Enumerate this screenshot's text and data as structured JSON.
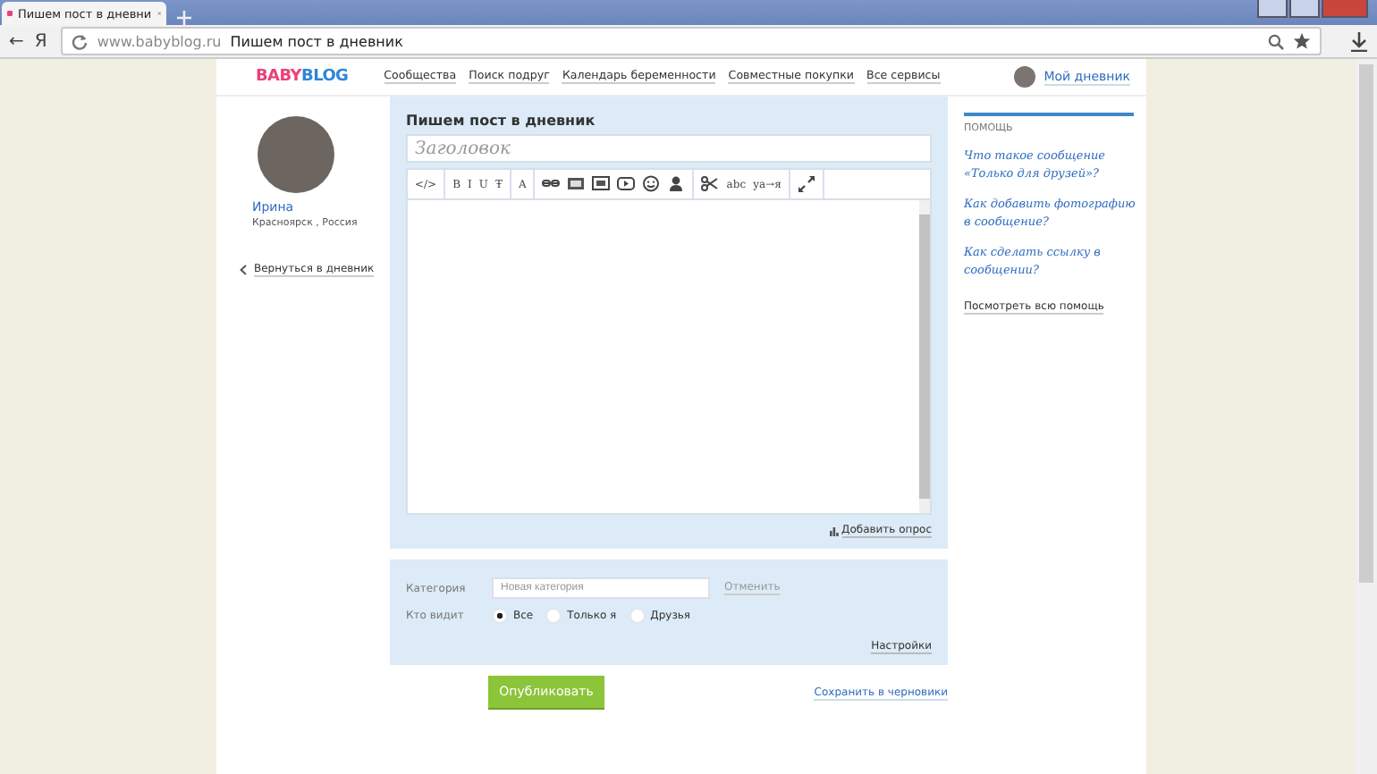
{
  "browser": {
    "tab_title": "Пишем пост в дневни",
    "url_host": "www.babyblog.ru",
    "url_title": "Пишем пост в дневник",
    "back": "←",
    "yandex": "Я"
  },
  "header": {
    "logo_left": "BABY",
    "logo_right": "BLOG",
    "nav": [
      "Сообщества",
      "Поиск подруг",
      "Календарь беременности",
      "Совместные покупки",
      "Все сервисы"
    ],
    "my_diary": "Мой дневник"
  },
  "profile": {
    "name": "Ирина",
    "location": "Красноярск , Россия",
    "back_link": "Вернуться в дневник"
  },
  "editor": {
    "heading": "Пишем пост в дневник",
    "title_placeholder": "Заголовок",
    "toolbar": [
      [
        {
          "kind": "text",
          "label": "</>"
        }
      ],
      [
        {
          "kind": "text",
          "label": "B"
        },
        {
          "kind": "text",
          "label": "I"
        },
        {
          "kind": "text",
          "label": "U"
        },
        {
          "kind": "text",
          "label": "Ŧ"
        }
      ],
      [
        {
          "kind": "text",
          "label": "A"
        }
      ],
      [
        {
          "kind": "link"
        },
        {
          "kind": "image"
        },
        {
          "kind": "gallery"
        },
        {
          "kind": "video"
        },
        {
          "kind": "smiley"
        },
        {
          "kind": "person"
        }
      ],
      [
        {
          "kind": "scissors"
        },
        {
          "kind": "text",
          "label": "abc"
        },
        {
          "kind": "text",
          "label": "ya→я"
        }
      ],
      [
        {
          "kind": "expand"
        }
      ]
    ],
    "add_poll": "Добавить опрос"
  },
  "settings": {
    "category_label": "Категория",
    "category_placeholder": "Новая категория",
    "cancel": "Отменить",
    "visibility_label": "Кто видит",
    "visibility": [
      {
        "label": "Все",
        "selected": true
      },
      {
        "label": "Только я",
        "selected": false
      },
      {
        "label": "Друзья",
        "selected": false
      }
    ],
    "settings_link": "Настройки"
  },
  "actions": {
    "publish": "Опубликовать",
    "save_draft": "Сохранить в черновики"
  },
  "help": {
    "title": "ПОМОЩЬ",
    "links": [
      "Что такое сообщение «Только для друзей»?",
      "Как добавить фотографию в сообщение?",
      "Как сделать ссылку в сообщении?"
    ],
    "all": "Посмотреть всю помощь"
  }
}
